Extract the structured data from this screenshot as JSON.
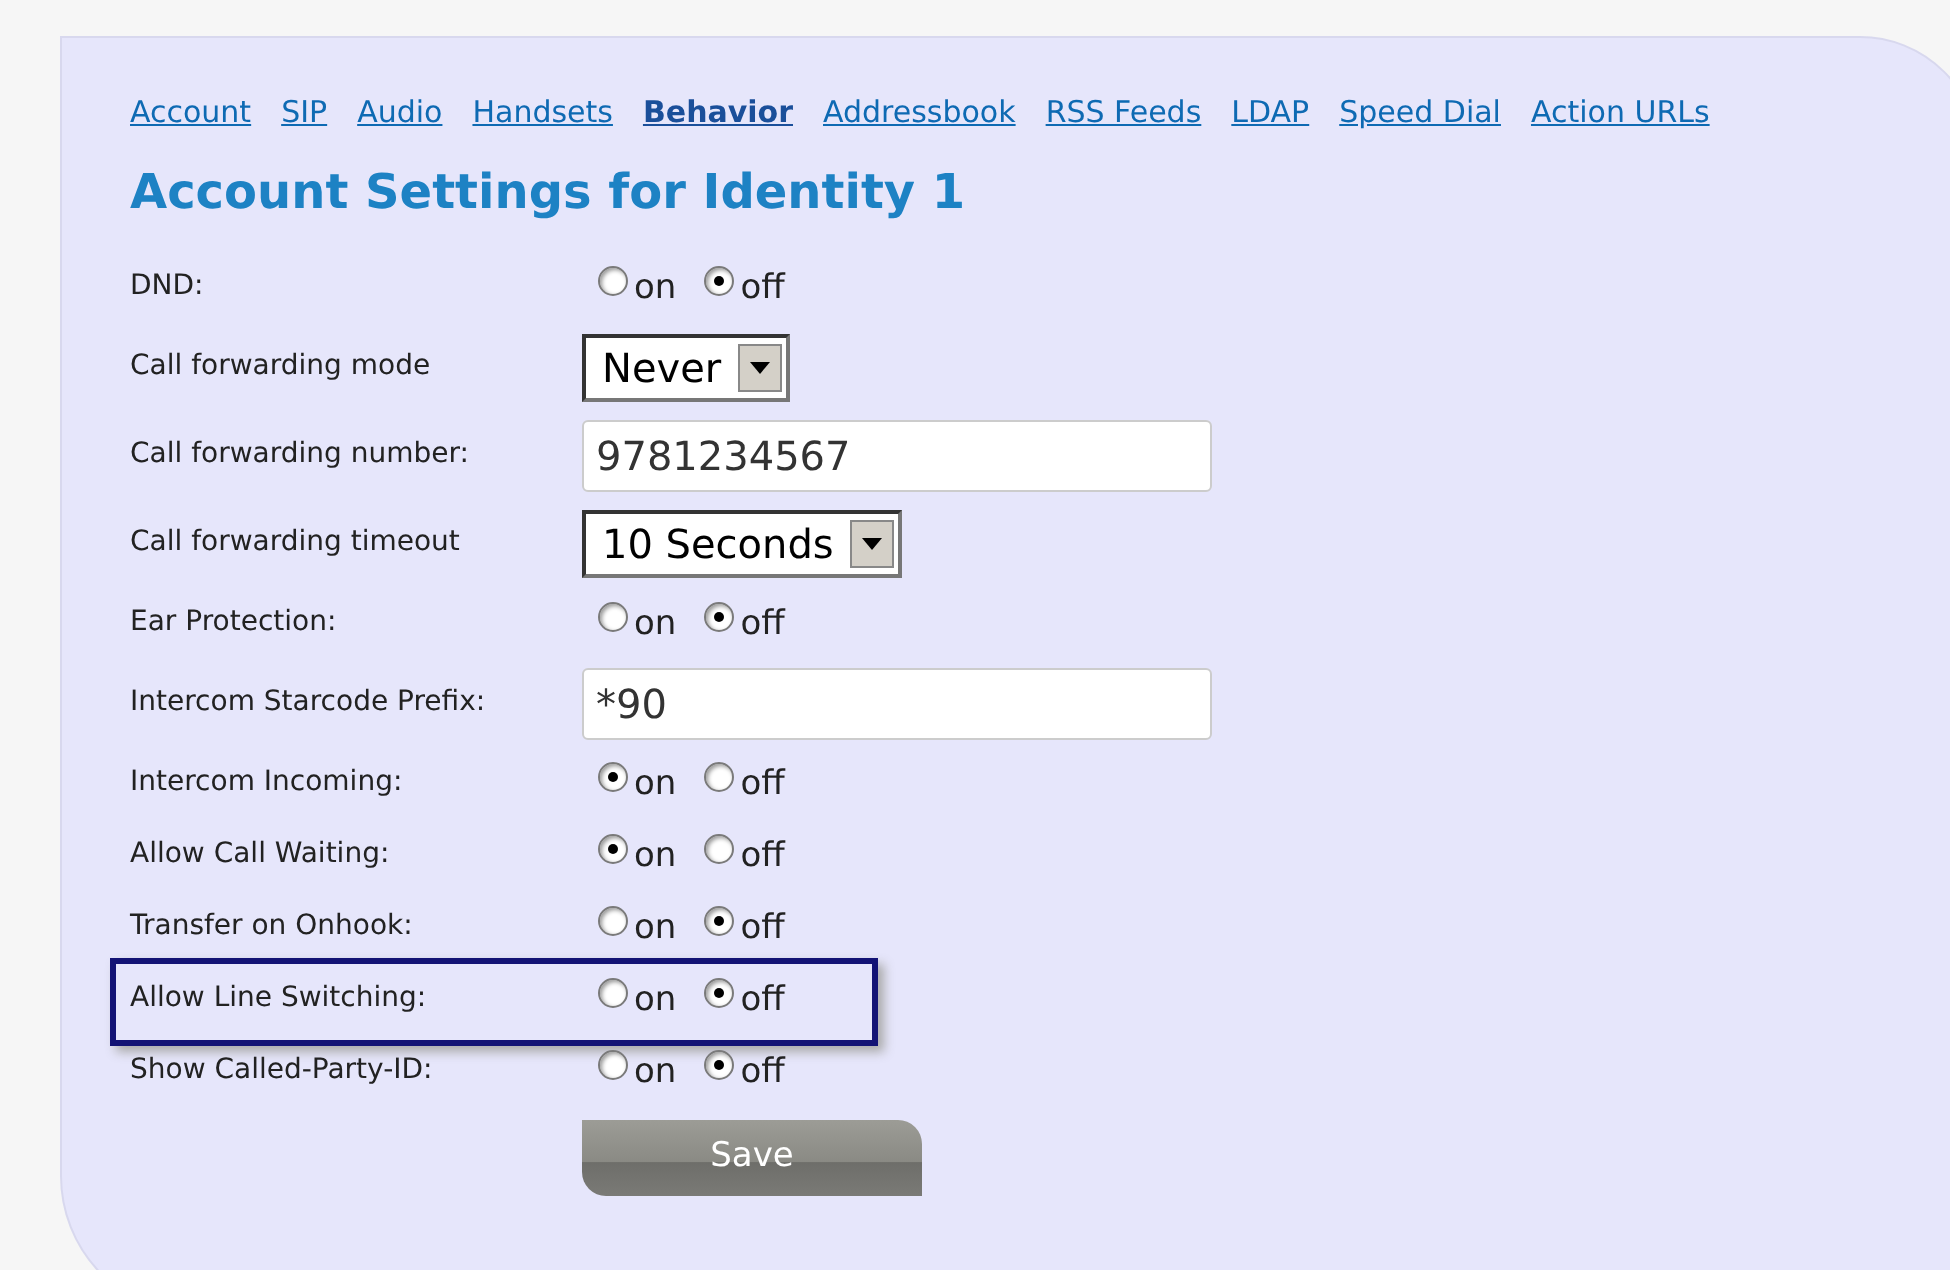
{
  "nav": [
    {
      "label": "Account",
      "selected": false
    },
    {
      "label": "SIP",
      "selected": false
    },
    {
      "label": "Audio",
      "selected": false
    },
    {
      "label": "Handsets",
      "selected": false
    },
    {
      "label": "Behavior",
      "selected": true
    },
    {
      "label": "Addressbook",
      "selected": false
    },
    {
      "label": "RSS Feeds",
      "selected": false
    },
    {
      "label": "LDAP",
      "selected": false
    },
    {
      "label": "Speed Dial",
      "selected": false
    },
    {
      "label": "Action URLs",
      "selected": false
    }
  ],
  "title": "Account Settings for Identity 1",
  "rows": [
    {
      "kind": "radio",
      "label": "DND:",
      "highlighted": false,
      "options": [
        {
          "label": "on",
          "selected": false
        },
        {
          "label": "off",
          "selected": true
        }
      ]
    },
    {
      "kind": "select",
      "label": "Call forwarding mode",
      "highlighted": false,
      "value": "Never"
    },
    {
      "kind": "text",
      "label": "Call forwarding number:",
      "highlighted": false,
      "value": "9781234567"
    },
    {
      "kind": "select",
      "label": "Call forwarding timeout",
      "highlighted": false,
      "value": "10 Seconds"
    },
    {
      "kind": "radio",
      "label": "Ear Protection:",
      "highlighted": false,
      "options": [
        {
          "label": "on",
          "selected": false
        },
        {
          "label": "off",
          "selected": true
        }
      ]
    },
    {
      "kind": "text",
      "label": "Intercom Starcode Prefix:",
      "highlighted": false,
      "value": "*90"
    },
    {
      "kind": "radio",
      "label": "Intercom Incoming:",
      "highlighted": false,
      "options": [
        {
          "label": "on",
          "selected": true
        },
        {
          "label": "off",
          "selected": false
        }
      ]
    },
    {
      "kind": "radio",
      "label": "Allow Call Waiting:",
      "highlighted": false,
      "options": [
        {
          "label": "on",
          "selected": true
        },
        {
          "label": "off",
          "selected": false
        }
      ]
    },
    {
      "kind": "radio",
      "label": "Transfer on Onhook:",
      "highlighted": false,
      "options": [
        {
          "label": "on",
          "selected": false
        },
        {
          "label": "off",
          "selected": true
        }
      ]
    },
    {
      "kind": "radio",
      "label": "Allow Line Switching:",
      "highlighted": true,
      "options": [
        {
          "label": "on",
          "selected": false
        },
        {
          "label": "off",
          "selected": true
        }
      ]
    },
    {
      "kind": "radio",
      "label": "Show Called-Party-ID:",
      "highlighted": false,
      "options": [
        {
          "label": "on",
          "selected": false
        },
        {
          "label": "off",
          "selected": true
        }
      ]
    }
  ],
  "save_button": "Save"
}
